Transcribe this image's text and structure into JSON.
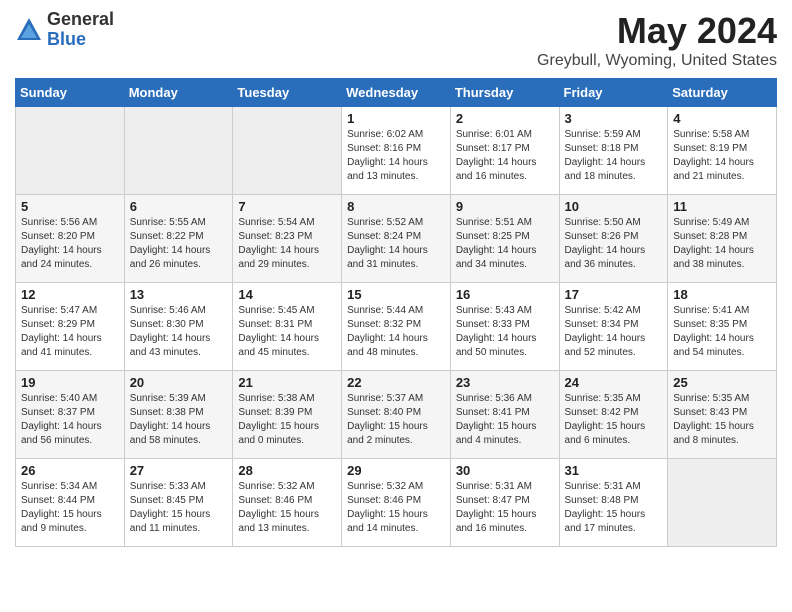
{
  "logo": {
    "general": "General",
    "blue": "Blue"
  },
  "header": {
    "month": "May 2024",
    "location": "Greybull, Wyoming, United States"
  },
  "days_of_week": [
    "Sunday",
    "Monday",
    "Tuesday",
    "Wednesday",
    "Thursday",
    "Friday",
    "Saturday"
  ],
  "weeks": [
    [
      {
        "day": "",
        "info": ""
      },
      {
        "day": "",
        "info": ""
      },
      {
        "day": "",
        "info": ""
      },
      {
        "day": "1",
        "info": "Sunrise: 6:02 AM\nSunset: 8:16 PM\nDaylight: 14 hours\nand 13 minutes."
      },
      {
        "day": "2",
        "info": "Sunrise: 6:01 AM\nSunset: 8:17 PM\nDaylight: 14 hours\nand 16 minutes."
      },
      {
        "day": "3",
        "info": "Sunrise: 5:59 AM\nSunset: 8:18 PM\nDaylight: 14 hours\nand 18 minutes."
      },
      {
        "day": "4",
        "info": "Sunrise: 5:58 AM\nSunset: 8:19 PM\nDaylight: 14 hours\nand 21 minutes."
      }
    ],
    [
      {
        "day": "5",
        "info": "Sunrise: 5:56 AM\nSunset: 8:20 PM\nDaylight: 14 hours\nand 24 minutes."
      },
      {
        "day": "6",
        "info": "Sunrise: 5:55 AM\nSunset: 8:22 PM\nDaylight: 14 hours\nand 26 minutes."
      },
      {
        "day": "7",
        "info": "Sunrise: 5:54 AM\nSunset: 8:23 PM\nDaylight: 14 hours\nand 29 minutes."
      },
      {
        "day": "8",
        "info": "Sunrise: 5:52 AM\nSunset: 8:24 PM\nDaylight: 14 hours\nand 31 minutes."
      },
      {
        "day": "9",
        "info": "Sunrise: 5:51 AM\nSunset: 8:25 PM\nDaylight: 14 hours\nand 34 minutes."
      },
      {
        "day": "10",
        "info": "Sunrise: 5:50 AM\nSunset: 8:26 PM\nDaylight: 14 hours\nand 36 minutes."
      },
      {
        "day": "11",
        "info": "Sunrise: 5:49 AM\nSunset: 8:28 PM\nDaylight: 14 hours\nand 38 minutes."
      }
    ],
    [
      {
        "day": "12",
        "info": "Sunrise: 5:47 AM\nSunset: 8:29 PM\nDaylight: 14 hours\nand 41 minutes."
      },
      {
        "day": "13",
        "info": "Sunrise: 5:46 AM\nSunset: 8:30 PM\nDaylight: 14 hours\nand 43 minutes."
      },
      {
        "day": "14",
        "info": "Sunrise: 5:45 AM\nSunset: 8:31 PM\nDaylight: 14 hours\nand 45 minutes."
      },
      {
        "day": "15",
        "info": "Sunrise: 5:44 AM\nSunset: 8:32 PM\nDaylight: 14 hours\nand 48 minutes."
      },
      {
        "day": "16",
        "info": "Sunrise: 5:43 AM\nSunset: 8:33 PM\nDaylight: 14 hours\nand 50 minutes."
      },
      {
        "day": "17",
        "info": "Sunrise: 5:42 AM\nSunset: 8:34 PM\nDaylight: 14 hours\nand 52 minutes."
      },
      {
        "day": "18",
        "info": "Sunrise: 5:41 AM\nSunset: 8:35 PM\nDaylight: 14 hours\nand 54 minutes."
      }
    ],
    [
      {
        "day": "19",
        "info": "Sunrise: 5:40 AM\nSunset: 8:37 PM\nDaylight: 14 hours\nand 56 minutes."
      },
      {
        "day": "20",
        "info": "Sunrise: 5:39 AM\nSunset: 8:38 PM\nDaylight: 14 hours\nand 58 minutes."
      },
      {
        "day": "21",
        "info": "Sunrise: 5:38 AM\nSunset: 8:39 PM\nDaylight: 15 hours\nand 0 minutes."
      },
      {
        "day": "22",
        "info": "Sunrise: 5:37 AM\nSunset: 8:40 PM\nDaylight: 15 hours\nand 2 minutes."
      },
      {
        "day": "23",
        "info": "Sunrise: 5:36 AM\nSunset: 8:41 PM\nDaylight: 15 hours\nand 4 minutes."
      },
      {
        "day": "24",
        "info": "Sunrise: 5:35 AM\nSunset: 8:42 PM\nDaylight: 15 hours\nand 6 minutes."
      },
      {
        "day": "25",
        "info": "Sunrise: 5:35 AM\nSunset: 8:43 PM\nDaylight: 15 hours\nand 8 minutes."
      }
    ],
    [
      {
        "day": "26",
        "info": "Sunrise: 5:34 AM\nSunset: 8:44 PM\nDaylight: 15 hours\nand 9 minutes."
      },
      {
        "day": "27",
        "info": "Sunrise: 5:33 AM\nSunset: 8:45 PM\nDaylight: 15 hours\nand 11 minutes."
      },
      {
        "day": "28",
        "info": "Sunrise: 5:32 AM\nSunset: 8:46 PM\nDaylight: 15 hours\nand 13 minutes."
      },
      {
        "day": "29",
        "info": "Sunrise: 5:32 AM\nSunset: 8:46 PM\nDaylight: 15 hours\nand 14 minutes."
      },
      {
        "day": "30",
        "info": "Sunrise: 5:31 AM\nSunset: 8:47 PM\nDaylight: 15 hours\nand 16 minutes."
      },
      {
        "day": "31",
        "info": "Sunrise: 5:31 AM\nSunset: 8:48 PM\nDaylight: 15 hours\nand 17 minutes."
      },
      {
        "day": "",
        "info": ""
      }
    ]
  ]
}
